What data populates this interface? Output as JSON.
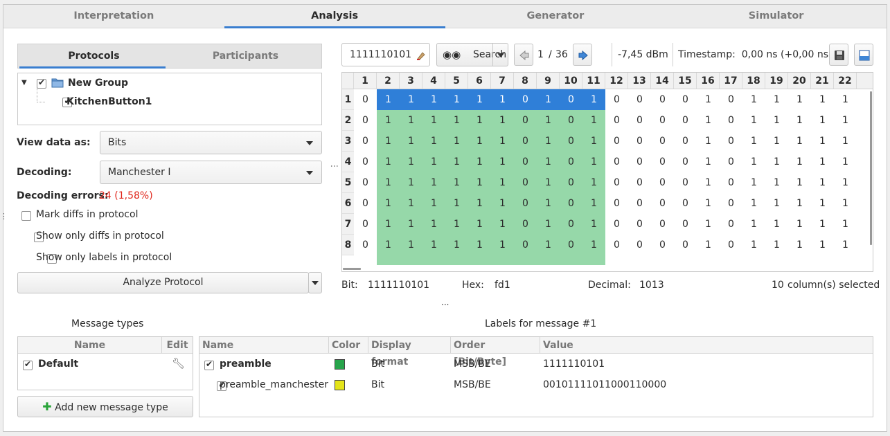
{
  "main_tabs": [
    "Interpretation",
    "Analysis",
    "Generator",
    "Simulator"
  ],
  "left": {
    "subtabs": [
      "Protocols",
      "Participants"
    ],
    "tree": {
      "group": "New Group",
      "item": "KitchenButton1"
    },
    "view_data_label": "View data as:",
    "view_data_value": "Bits",
    "decoding_label": "Decoding:",
    "decoding_value": "Manchester I",
    "decoding_errors_label": "Decoding errors:",
    "decoding_errors_value": "24 (1,58%)",
    "checks": [
      "Mark diffs in protocol",
      "Show only diffs in protocol",
      "Show only labels in protocol"
    ],
    "analyze_button": "Analyze Protocol"
  },
  "toolbar": {
    "search_value": "1111110101",
    "search_button": "Search",
    "page_current": "1",
    "page_sep": "/",
    "page_total": "36",
    "rssi": "-7,45 dBm",
    "timestamp": "Timestamp:  0,00 ns (+0,00 ns)"
  },
  "grid": {
    "columns": [
      "1",
      "2",
      "3",
      "4",
      "5",
      "6",
      "7",
      "8",
      "9",
      "10",
      "11",
      "12",
      "13",
      "14",
      "15",
      "16",
      "17",
      "18",
      "19",
      "20",
      "21",
      "22"
    ],
    "rows": [
      "1",
      "2",
      "3",
      "4",
      "5",
      "6",
      "7",
      "8"
    ],
    "row_bits": [
      "0",
      "1",
      "1",
      "1",
      "1",
      "1",
      "1",
      "0",
      "1",
      "0",
      "1",
      "0",
      "0",
      "0",
      "0",
      "1",
      "0",
      "1",
      "1",
      "1",
      "1",
      "1"
    ],
    "selected_row": 0,
    "selected_range": [
      1,
      10
    ],
    "label_range": [
      1,
      10
    ],
    "label_color": "#96d8a9",
    "selection_color": "#2f7fd8"
  },
  "status": {
    "bit_label": "Bit:",
    "bit_value": "1111110101",
    "hex_label": "Hex:",
    "hex_value": "fd1",
    "decimal_label": "Decimal:",
    "decimal_value": "1013",
    "selected_count": "10",
    "selected_text": "column(s) selected"
  },
  "splitter_dots": "...",
  "message_types": {
    "title": "Message types",
    "headers": [
      "Name",
      "Edit"
    ],
    "rows": [
      {
        "name": "Default"
      }
    ],
    "add_button": "Add new message type"
  },
  "labels": {
    "title": "Labels for message #1",
    "headers": [
      "Name",
      "Color",
      "Display format",
      "Order [Bit/Byte]",
      "Value"
    ],
    "rows": [
      {
        "name": "preamble",
        "color": "#27a44b",
        "format": "Bit",
        "order": "MSB/BE",
        "value": "1111110101",
        "bold": true
      },
      {
        "name": "preamble_manchester",
        "color": "#e4e41a",
        "format": "Bit",
        "order": "MSB/BE",
        "value": "00101111011000110000",
        "bold": false
      }
    ]
  }
}
